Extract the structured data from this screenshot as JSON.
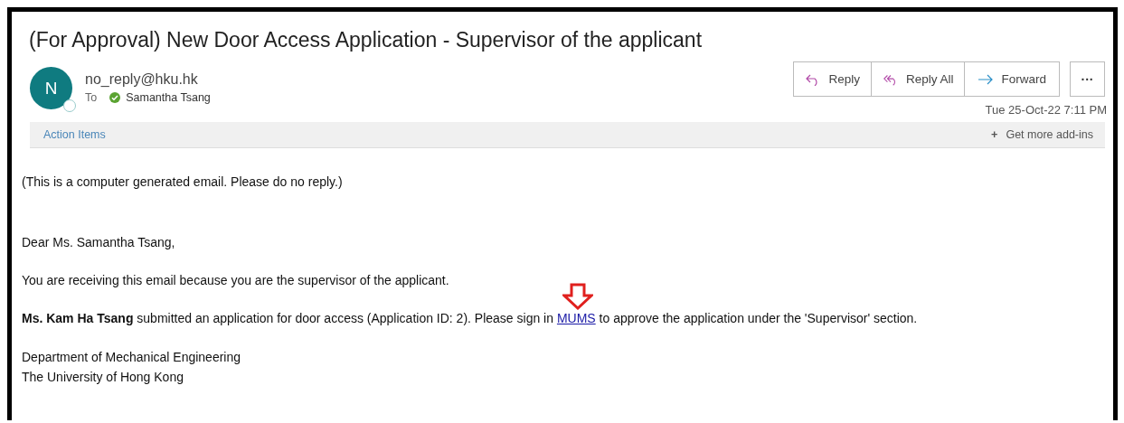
{
  "subject": "(For Approval) New Door Access Application - Supervisor of the applicant",
  "sender": {
    "avatar_letter": "N",
    "address": "no_reply@hku.hk",
    "to_label": "To",
    "recipient": "Samantha Tsang"
  },
  "actions": [
    {
      "kind": "reply",
      "label": "Reply"
    },
    {
      "kind": "reply_all",
      "label": "Reply All"
    },
    {
      "kind": "forward",
      "label": "Forward"
    }
  ],
  "more_button": "···",
  "date": "Tue 25-Oct-22 7:11 PM",
  "addin_bar": {
    "left": "Action Items",
    "right_icon": "+",
    "right": "Get more add-ins"
  },
  "body": {
    "notice": "(This is a computer generated email. Please do no reply.)",
    "greeting": "Dear Ms. Samantha Tsang,",
    "reason": "You are receiving this email because you are the supervisor of the applicant.",
    "request": {
      "before": "**Ms. Kam Ha Tsang** submitted an application for door access (Application ID: 2). Please sign in ",
      "link": "MUMS",
      "after": " to approve the application under the 'Supervisor' section."
    },
    "signature": [
      "Department of Mechanical Engineering",
      "The University of Hong Kong"
    ]
  }
}
